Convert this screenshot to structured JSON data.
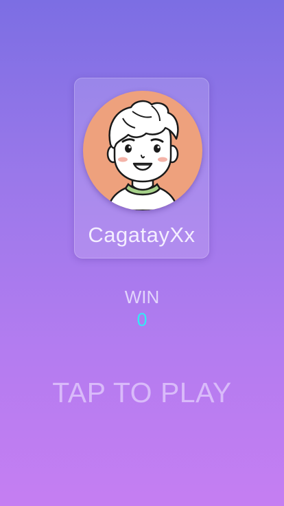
{
  "profile": {
    "avatar_icon": "cartoon-boy-avatar",
    "avatar_bg_color": "#eea17d",
    "username": "CagatayXx"
  },
  "stats": {
    "win_label": "WIN",
    "win_value": "0",
    "win_value_color": "#34eaf5"
  },
  "actions": {
    "tap_to_play_label": "TAP TO PLAY"
  },
  "theme": {
    "background_top": "#7c6ee3",
    "background_bottom": "#c57ef2"
  }
}
